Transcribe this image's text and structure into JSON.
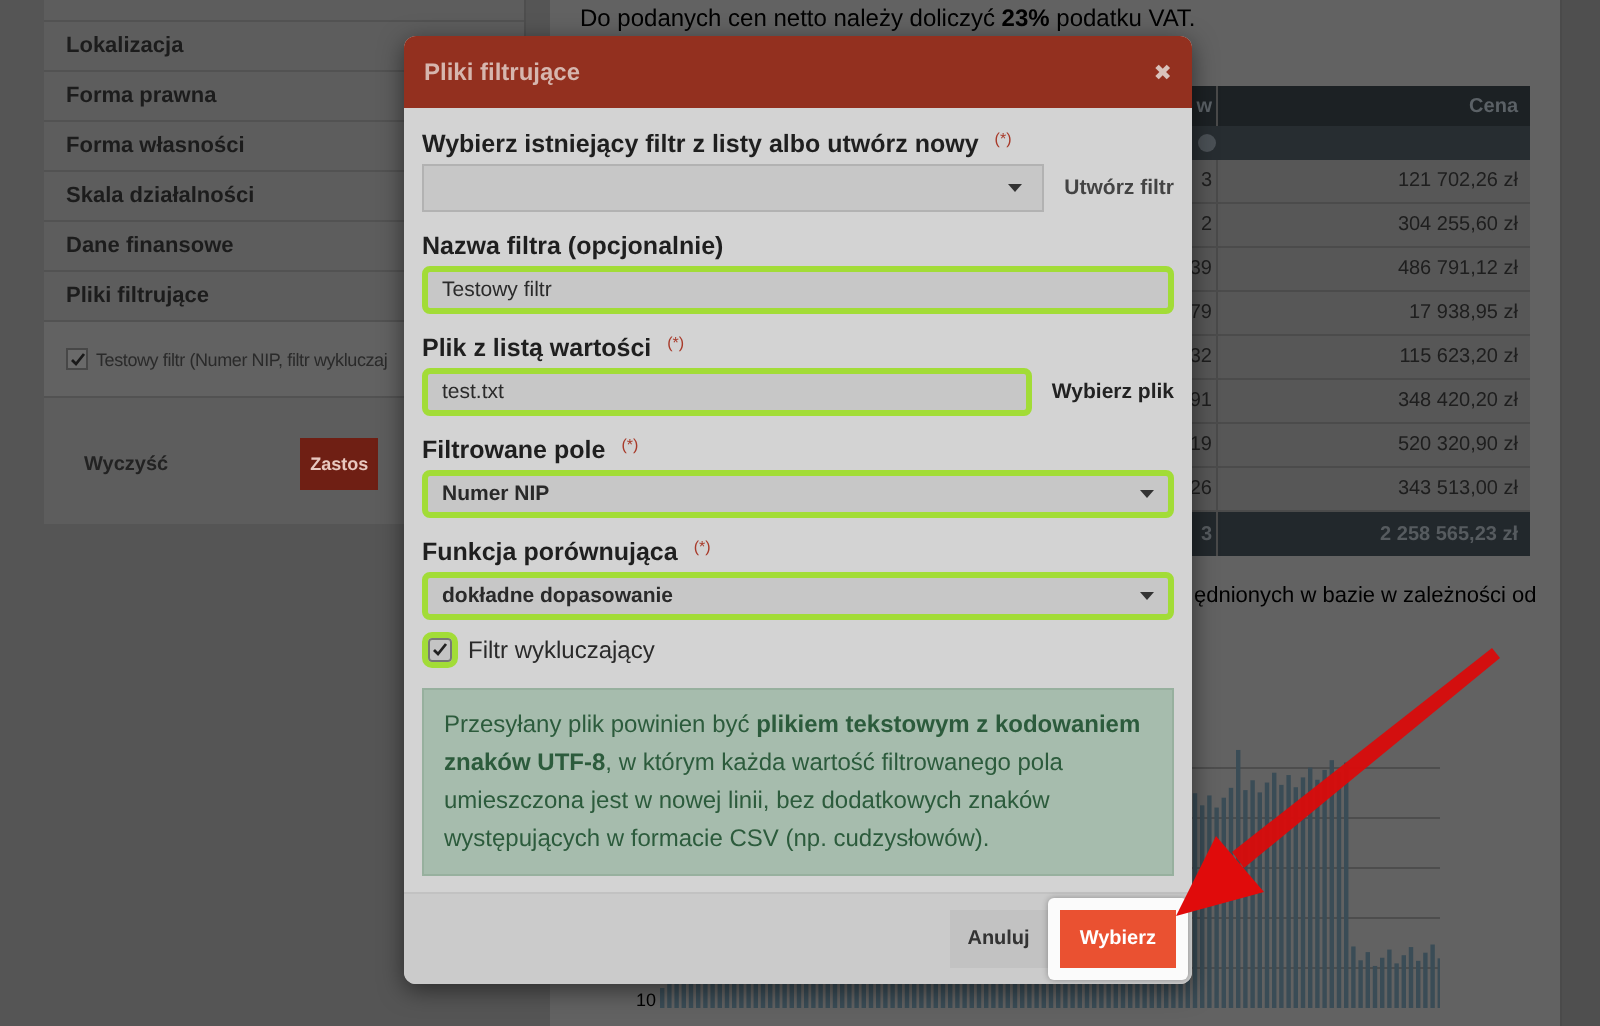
{
  "sidebar": {
    "items": [
      {
        "label": "Lokalizacja"
      },
      {
        "label": "Forma prawna"
      },
      {
        "label": "Forma własności"
      },
      {
        "label": "Skala działalności"
      },
      {
        "label": "Dane finansowe"
      },
      {
        "label": "Pliki filtrujące"
      }
    ],
    "filters": [
      {
        "label": "Testowy filtr (Numer NIP, filtr wykluczaj",
        "checked": true
      }
    ],
    "buttons": [
      {
        "label": "Wyczyść",
        "kind": "plain"
      },
      {
        "label": "Zastos",
        "kind": "primary"
      }
    ]
  },
  "main": {
    "vat_note": "Do podanych cen netto należy doliczyć **23%** podatku VAT.",
    "table": {
      "columns": [
        "w",
        "Cena"
      ],
      "rows": [
        [
          "3",
          "121 702,26 zł"
        ],
        [
          "2",
          "304 255,60 zł"
        ],
        [
          "39",
          "486 791,12 zł"
        ],
        [
          "79",
          "17 938,95 zł"
        ],
        [
          "32",
          "115 623,20 zł"
        ],
        [
          "91",
          "348 420,20 zł"
        ],
        [
          "19",
          "520 320,90 zł"
        ],
        [
          "26",
          "343 513,00 zł"
        ]
      ],
      "footer": [
        "3",
        "2 258 565,23 zł"
      ]
    },
    "paragraph": "ędnionych w bazie w zależności od",
    "chart_axis_label": "10"
  },
  "modal": {
    "title": "Pliki filtrujące",
    "close": "✖",
    "fields": [
      {
        "label": "Wybierz istniejący filtr z listy albo utwórz nowy",
        "required": true,
        "kind": "select",
        "highlighted": false,
        "action": "Utwórz filtr"
      },
      {
        "label": "Nazwa filtra (opcjonalnie)",
        "required": false,
        "kind": "input",
        "value": "Testowy filtr",
        "highlighted": true
      },
      {
        "label": "Plik z listą wartości",
        "required": true,
        "kind": "input",
        "value": "test.txt",
        "highlighted": true,
        "action": "Wybierz plik"
      },
      {
        "label": "Filtrowane pole",
        "required": true,
        "kind": "select",
        "value": "Numer NIP",
        "highlighted": true
      },
      {
        "label": "Funkcja porównująca",
        "required": true,
        "kind": "select",
        "value": "dokładne dopasowanie",
        "highlighted": true
      }
    ],
    "required_mark": "(*)",
    "checkbox": {
      "label": "Filtr wykluczający",
      "checked": true,
      "highlighted": true
    },
    "info": "Przesyłany plik powinien być **plikiem tekstowym z kodowaniem znaków UTF-8**, w którym każda wartość filtrowanego pola umieszczona jest w nowej linii, bez dodatkowych znaków występujących w formacie CSV (np. cudzysłowów).",
    "buttons": [
      {
        "label": "Anuluj",
        "kind": "plain",
        "highlighted": false
      },
      {
        "label": "Wybierz",
        "kind": "primary",
        "highlighted": true
      }
    ]
  }
}
